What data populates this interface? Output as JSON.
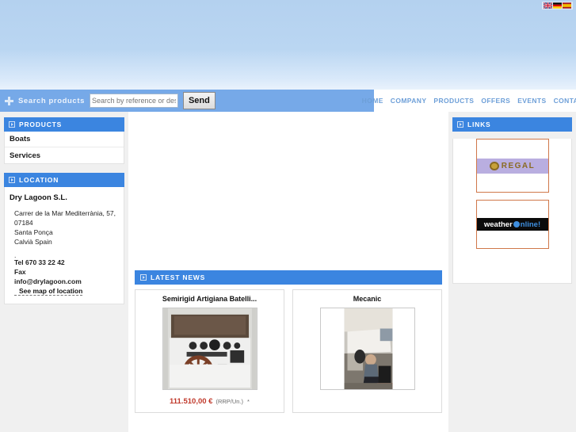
{
  "header": {
    "flags": [
      {
        "name": "flag-uk",
        "label": "English"
      },
      {
        "name": "flag-de",
        "label": "Deutsch"
      },
      {
        "name": "flag-es",
        "label": "Espanol"
      }
    ]
  },
  "search": {
    "icon": "plus-icon",
    "label": "Search products",
    "placeholder": "Search by reference or description",
    "value": "",
    "button_label": "Send"
  },
  "nav": {
    "items": [
      {
        "label": "HOME"
      },
      {
        "label": "COMPANY"
      },
      {
        "label": "PRODUCTS"
      },
      {
        "label": "OFFERS"
      },
      {
        "label": "EVENTS"
      },
      {
        "label": "CONTACT"
      }
    ]
  },
  "sidebar_left": {
    "products_panel": {
      "title": "PRODUCTS",
      "icon": "arrow-box-icon",
      "items": [
        {
          "label": "Boats"
        },
        {
          "label": "Services"
        }
      ]
    },
    "location_panel": {
      "title": "LOCATION",
      "icon": "arrow-box-icon",
      "company": "Dry Lagoon S.L.",
      "address_lines": [
        "Carrer de la Mar Mediterrània, 57, 07184",
        "Santa Ponça",
        "Calvià Spain"
      ],
      "separator": ".",
      "phone": "Tel 670 33 22 42",
      "fax": "Fax",
      "email": "info@drylagoon.com",
      "map_link": "See map of location"
    }
  },
  "main": {
    "news_panel": {
      "title": "LATEST NEWS",
      "icon": "arrow-box-icon",
      "items": [
        {
          "title": "Semirigid Artigiana Batelli...",
          "image_name": "boat-cockpit-photo",
          "price": "111.510,00 €",
          "price_unit": "(RRP/Un.)",
          "price_note": "*"
        },
        {
          "title": "Mecanic",
          "image_name": "mechanic-working-photo",
          "price": "",
          "price_unit": "",
          "price_note": ""
        }
      ]
    }
  },
  "sidebar_right": {
    "links_panel": {
      "title": "LINKS",
      "icon": "arrow-box-icon",
      "items": [
        {
          "name": "regal-boats-logo",
          "label": "REGAL"
        },
        {
          "name": "weather-online-logo",
          "label_a": "weather",
          "label_b": "nline!"
        }
      ]
    }
  },
  "colors": {
    "accent_blue": "#3b85e0",
    "nav_blue": "#76a9e8",
    "price_red": "#c0392b",
    "link_border": "#d0784a"
  }
}
